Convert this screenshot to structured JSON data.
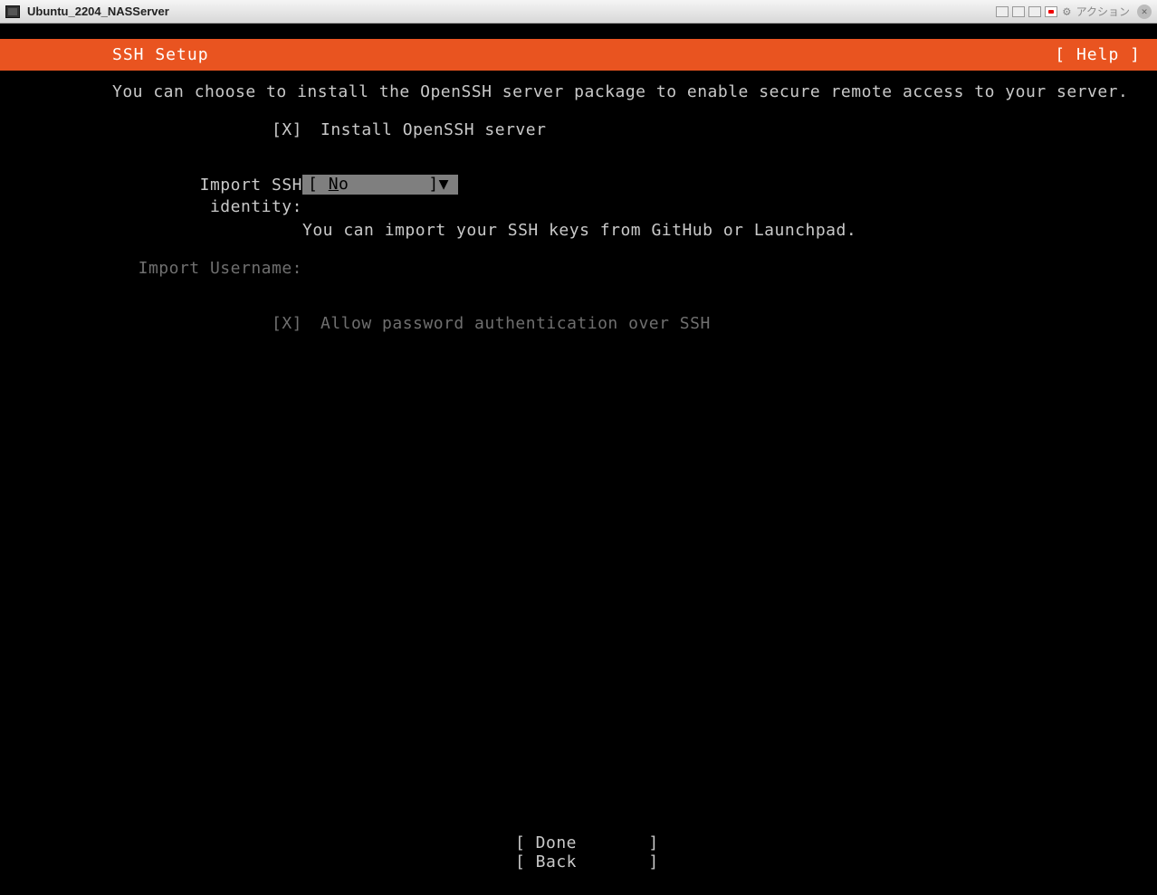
{
  "vm": {
    "title": "Ubuntu_2204_NASServer",
    "action_label": "アクション"
  },
  "installer": {
    "header_title": "SSH Setup",
    "help_label": "[ Help ]",
    "description": "You can choose to install the OpenSSH server package to enable secure remote access to your server.",
    "install_openssh": {
      "checkbox": "[X]",
      "label": "Install OpenSSH server"
    },
    "import_identity": {
      "label": "Import SSH identity:",
      "value": "No",
      "hint": "You can import your SSH keys from GitHub or Launchpad."
    },
    "import_username": {
      "label": "Import Username:"
    },
    "allow_password": {
      "checkbox": "[X]",
      "label": "Allow password authentication over SSH"
    },
    "buttons": {
      "done": "[ Done       ]",
      "back": "[ Back       ]"
    }
  }
}
